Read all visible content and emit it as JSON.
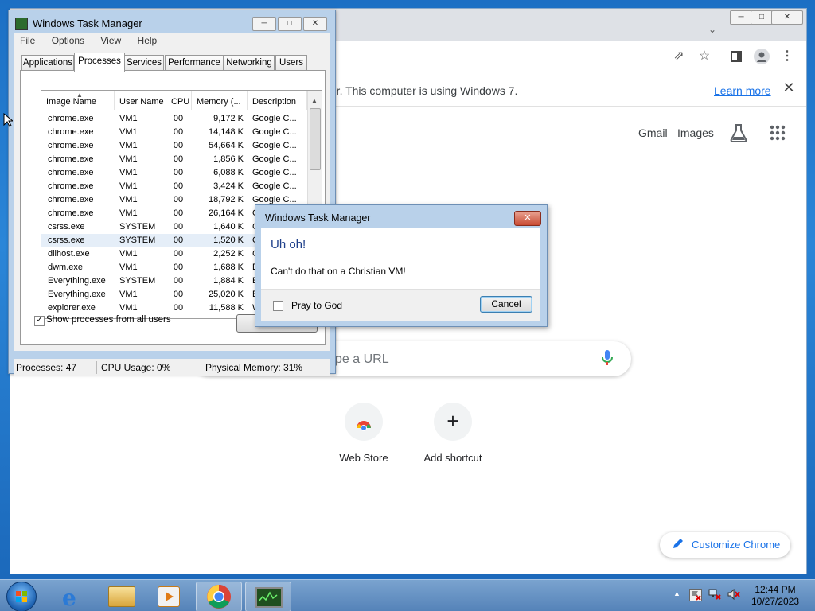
{
  "chrome": {
    "infobar_message": "ter. This computer is using Windows 7.",
    "infobar_link": "Learn more",
    "gmail": "Gmail",
    "images": "Images",
    "search_placeholder": "pe a URL",
    "shortcuts": [
      {
        "label": "Web Store"
      },
      {
        "label": "Add shortcut"
      }
    ],
    "customize_label": "Customize Chrome"
  },
  "taskmgr": {
    "title": "Windows Task Manager",
    "menu": [
      "File",
      "Options",
      "View",
      "Help"
    ],
    "tabs": [
      "Applications",
      "Processes",
      "Services",
      "Performance",
      "Networking",
      "Users"
    ],
    "active_tab": "Processes",
    "columns": [
      "Image Name",
      "User Name",
      "CPU",
      "Memory (...",
      "Description"
    ],
    "rows": [
      [
        "chrome.exe",
        "VM1",
        "00",
        "9,172 K",
        "Google C..."
      ],
      [
        "chrome.exe",
        "VM1",
        "00",
        "14,148 K",
        "Google C..."
      ],
      [
        "chrome.exe",
        "VM1",
        "00",
        "54,664 K",
        "Google C..."
      ],
      [
        "chrome.exe",
        "VM1",
        "00",
        "1,856 K",
        "Google C..."
      ],
      [
        "chrome.exe",
        "VM1",
        "00",
        "6,088 K",
        "Google C..."
      ],
      [
        "chrome.exe",
        "VM1",
        "00",
        "3,424 K",
        "Google C..."
      ],
      [
        "chrome.exe",
        "VM1",
        "00",
        "18,792 K",
        "Google C..."
      ],
      [
        "chrome.exe",
        "VM1",
        "00",
        "26,164 K",
        "Google C..."
      ],
      [
        "csrss.exe",
        "SYSTEM",
        "00",
        "1,640 K",
        "Clie"
      ],
      [
        "csrss.exe",
        "SYSTEM",
        "00",
        "1,520 K",
        "Clie"
      ],
      [
        "dllhost.exe",
        "VM1",
        "00",
        "2,252 K",
        "CO"
      ],
      [
        "dwm.exe",
        "VM1",
        "00",
        "1,688 K",
        "Des"
      ],
      [
        "Everything.exe",
        "SYSTEM",
        "00",
        "1,884 K",
        "Eve"
      ],
      [
        "Everything.exe",
        "VM1",
        "00",
        "25,020 K",
        "Eve"
      ],
      [
        "explorer.exe",
        "VM1",
        "00",
        "11,588 K",
        "Win"
      ]
    ],
    "selected_row": 9,
    "show_all_label": "Show processes from all users",
    "end_process_label": "E",
    "status": {
      "processes": "Processes: 47",
      "cpu": "CPU Usage: 0%",
      "memory": "Physical Memory: 31%"
    }
  },
  "dialog": {
    "title": "Windows Task Manager",
    "heading": "Uh oh!",
    "message": "Can't do that on a Christian VM!",
    "checkbox_label": "Pray to God",
    "cancel_label": "Cancel"
  },
  "taskbar": {
    "time": "12:44 PM",
    "date": "10/27/2023"
  }
}
